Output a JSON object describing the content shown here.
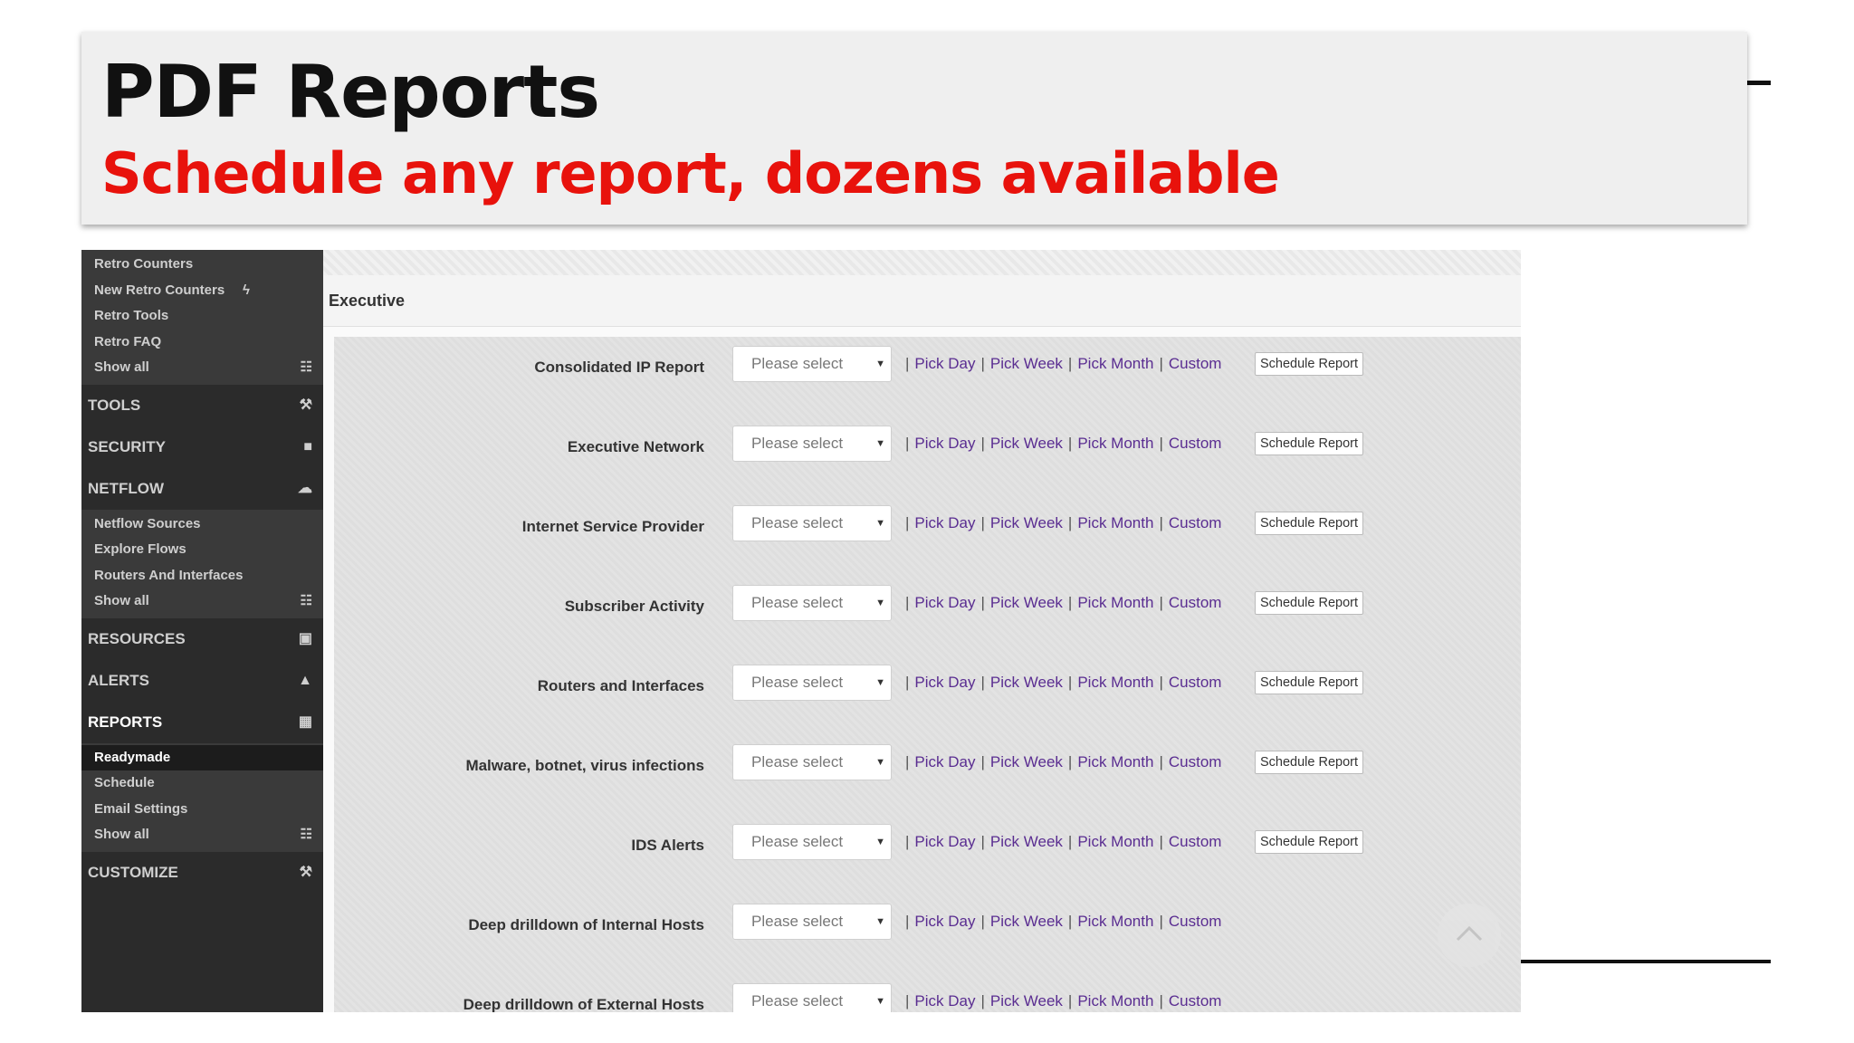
{
  "banner": {
    "title": "PDF Reports",
    "subtitle": "Schedule any report, dozens available"
  },
  "sidebar": {
    "groups": [
      {
        "type": "sub",
        "items": [
          {
            "label": "Retro Counters",
            "icon": ""
          },
          {
            "label": "New Retro Counters",
            "icon": "bolt-icon"
          },
          {
            "label": "Retro Tools",
            "icon": ""
          },
          {
            "label": "Retro FAQ",
            "icon": ""
          },
          {
            "label": "Show all",
            "icon": "grid-icon"
          }
        ]
      },
      {
        "type": "section",
        "label": "TOOLS",
        "icon": "wrench-icon"
      },
      {
        "type": "section",
        "label": "SECURITY",
        "icon": "lock-icon"
      },
      {
        "type": "section",
        "label": "NETFLOW",
        "icon": "cloud-icon"
      },
      {
        "type": "sub",
        "items": [
          {
            "label": "Netflow Sources",
            "icon": ""
          },
          {
            "label": "Explore Flows",
            "icon": ""
          },
          {
            "label": "Routers And Interfaces",
            "icon": ""
          },
          {
            "label": "Show all",
            "icon": "grid-icon"
          }
        ]
      },
      {
        "type": "section",
        "label": "RESOURCES",
        "icon": "image-icon"
      },
      {
        "type": "section",
        "label": "ALERTS",
        "icon": "bell-icon"
      },
      {
        "type": "section",
        "label": "REPORTS",
        "icon": "calendar-icon",
        "active": true
      },
      {
        "type": "sub",
        "items": [
          {
            "label": "Readymade",
            "icon": "",
            "active": true
          },
          {
            "label": "Schedule",
            "icon": ""
          },
          {
            "label": "Email Settings",
            "icon": ""
          },
          {
            "label": "Show all",
            "icon": "grid-icon"
          }
        ]
      },
      {
        "type": "section",
        "label": "CUSTOMIZE",
        "icon": "hammer-icon"
      }
    ]
  },
  "main": {
    "section_title": "Executive",
    "select_placeholder": "Please select",
    "link_labels": {
      "day": "Pick Day",
      "week": "Pick Week",
      "month": "Pick Month",
      "custom": "Custom"
    },
    "schedule_label": "Schedule Report",
    "reports": [
      {
        "name": "Consolidated IP Report",
        "schedulable": true
      },
      {
        "name": "Executive Network",
        "schedulable": true
      },
      {
        "name": "Internet Service Provider",
        "schedulable": true
      },
      {
        "name": "Subscriber Activity",
        "schedulable": true
      },
      {
        "name": "Routers and Interfaces",
        "schedulable": true
      },
      {
        "name": "Malware, botnet, virus infections",
        "schedulable": true
      },
      {
        "name": "IDS Alerts",
        "schedulable": true
      },
      {
        "name": "Deep drilldown of Internal Hosts",
        "schedulable": false
      },
      {
        "name": "Deep drilldown of External Hosts",
        "schedulable": false
      }
    ]
  },
  "colors": {
    "accent_red": "#e8120c",
    "link_purple": "#5a2d91",
    "sidebar_bg": "#2b2b2b"
  }
}
